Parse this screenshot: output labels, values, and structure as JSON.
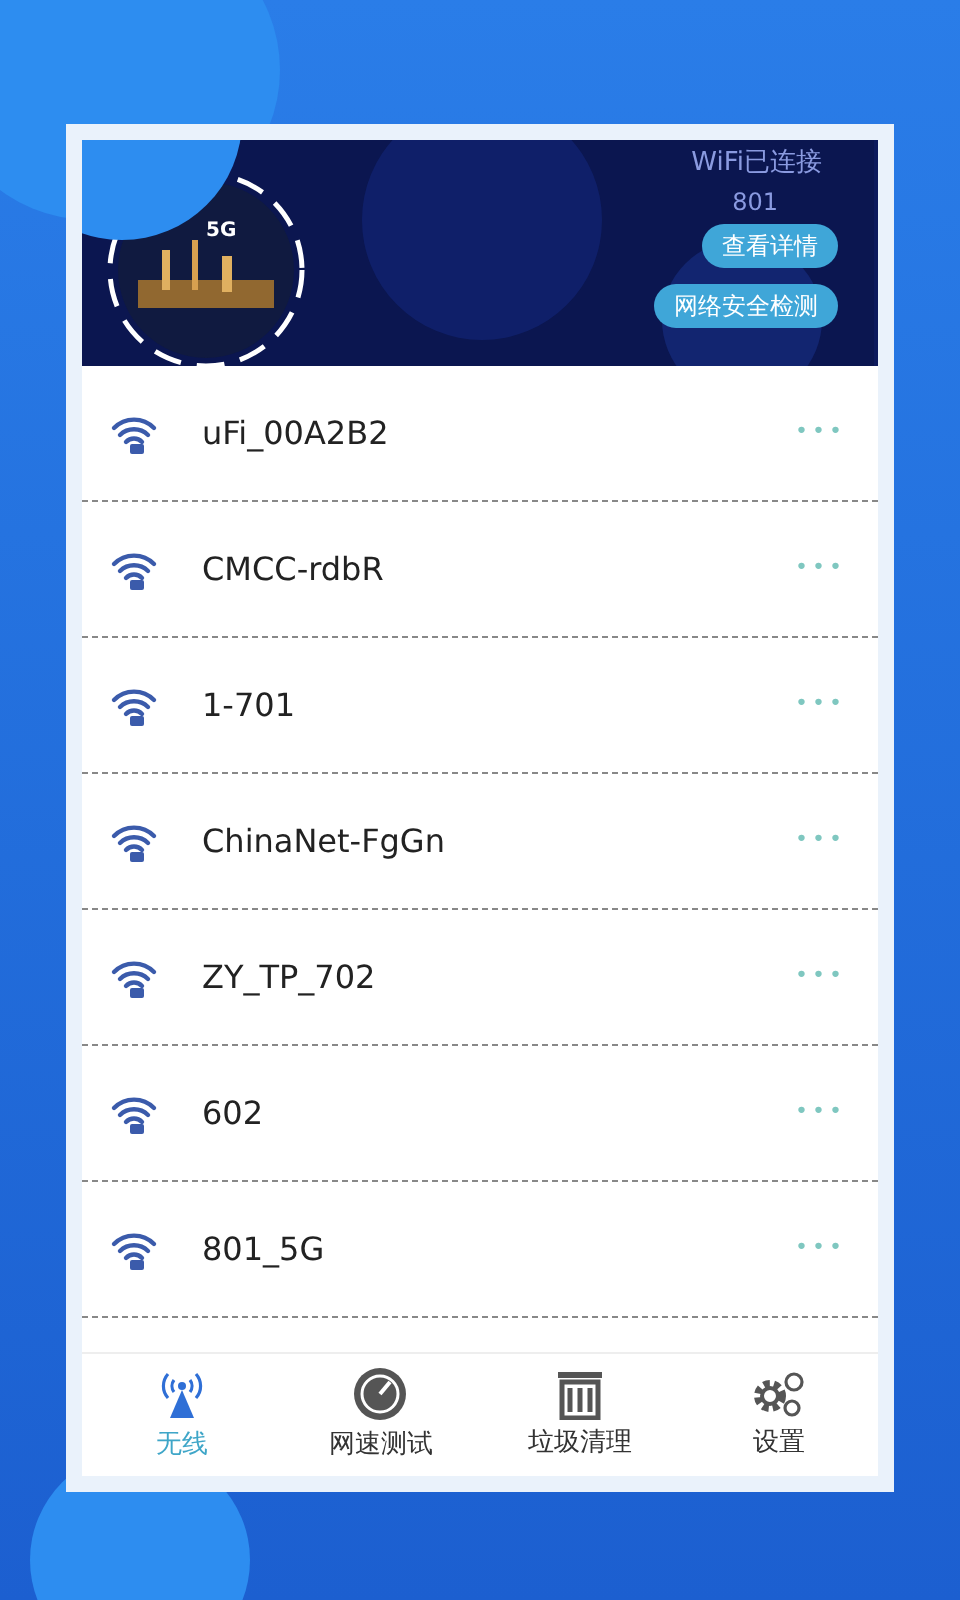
{
  "header": {
    "status_title": "WiFi已连接",
    "status_detail": "801",
    "badge": "5G",
    "buttons": [
      "查看详情",
      "网络安全检测"
    ]
  },
  "networks": [
    {
      "name": "uFi_00A2B2",
      "more": "•••"
    },
    {
      "name": "CMCC-rdbR",
      "more": "•••"
    },
    {
      "name": "1-701",
      "more": "•••"
    },
    {
      "name": "ChinaNet-FgGn",
      "more": "•••"
    },
    {
      "name": "ZY_TP_702",
      "more": "•••"
    },
    {
      "name": "602",
      "more": "•••"
    },
    {
      "name": "801_5G",
      "more": "•••"
    }
  ],
  "tabs": [
    {
      "label": "无线",
      "kind": "wireless",
      "selected": true
    },
    {
      "label": "网速测试",
      "kind": "speed",
      "selected": false
    },
    {
      "label": "垃圾清理",
      "kind": "trash",
      "selected": false
    },
    {
      "label": "设置",
      "kind": "settings",
      "selected": false
    }
  ]
}
